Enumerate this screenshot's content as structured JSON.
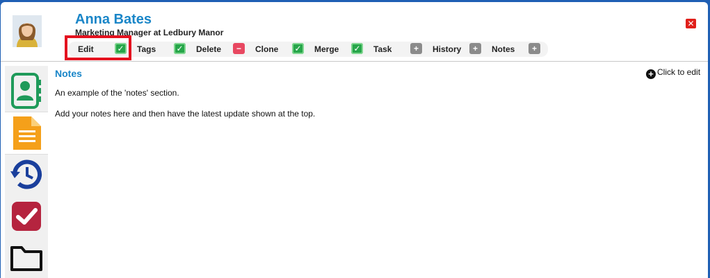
{
  "contact": {
    "name": "Anna Bates",
    "subtitle": "Marketing Manager at Ledbury Manor"
  },
  "toolbar": {
    "items": [
      {
        "label": "Edit",
        "icon": "check",
        "color": "#27a64a"
      },
      {
        "label": "Tags",
        "icon": "check",
        "color": "#27a64a"
      },
      {
        "label": "Delete",
        "icon": "minus",
        "color": "#e84861"
      },
      {
        "label": "Clone",
        "icon": "check",
        "color": "#27a64a"
      },
      {
        "label": "Merge",
        "icon": "check",
        "color": "#27a64a"
      },
      {
        "label": "Task",
        "icon": "plus",
        "color": "#8b8b8b"
      },
      {
        "label": "History",
        "icon": "plus",
        "color": "#8b8b8b"
      },
      {
        "label": "Notes",
        "icon": "plus",
        "color": "#8b8b8b"
      }
    ]
  },
  "sidebar": {
    "items": [
      {
        "icon": "contact-card-icon",
        "color": "#1f9a5a"
      },
      {
        "icon": "document-icon",
        "color": "#f5a01a",
        "active": true
      },
      {
        "icon": "history-clock-icon",
        "color": "#1a3f9c"
      },
      {
        "icon": "checkmark-task-icon",
        "color": "#b5243f"
      },
      {
        "icon": "folder-icon",
        "color": "#111111"
      }
    ]
  },
  "section": {
    "title": "Notes",
    "edit_label": "Click to edit",
    "lines": [
      "An example of the 'notes' section.",
      "Add your notes here and then have the latest update shown at the top."
    ]
  },
  "colors": {
    "accent": "#1a86c8",
    "frame": "#1f5fb4",
    "highlight": "#e4121f"
  }
}
